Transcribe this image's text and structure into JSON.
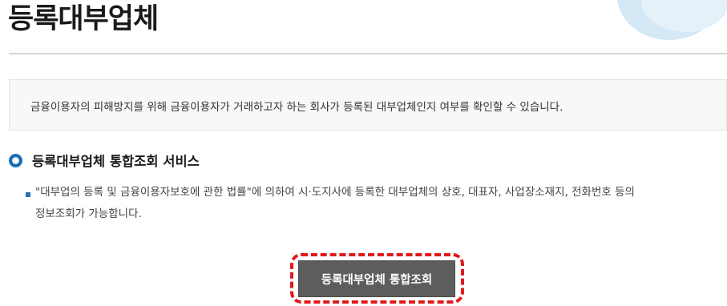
{
  "page_title": "등록대부업체",
  "info": {
    "text": "금융이용자의 피해방지를 위해 금융이용자가 거래하고자 하는 회사가 등록된 대부업체인지 여부를 확인할 수 있습니다."
  },
  "section": {
    "title": "등록대부업체 통합조회 서비스",
    "description_line1": "\"대부업의 등록 및 금융이용자보호에 관한 법률\"에 의하여 시·도지사에 등록한 대부업체의 상호, 대표자, 사업장소재지, 전화번호 등의",
    "description_line2": "정보조회가 가능합니다."
  },
  "actions": {
    "search_button_label": "등록대부업체 통합조회"
  },
  "colors": {
    "button_bg": "#5d5d5d",
    "highlight": "#e0191b",
    "accent_blue": "#1c6fb5"
  }
}
